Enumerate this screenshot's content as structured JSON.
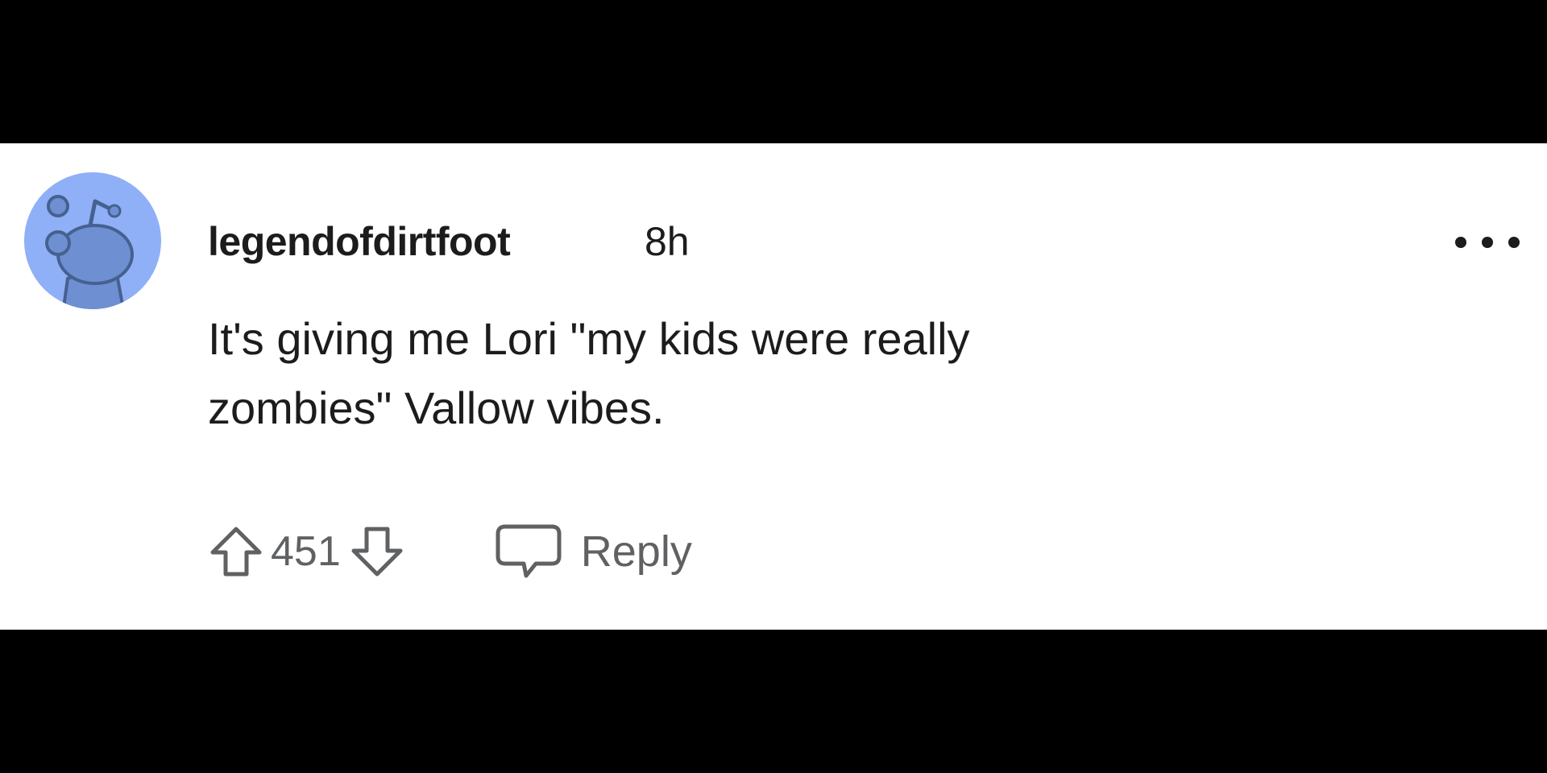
{
  "comment": {
    "avatar_icon": "reddit-snoo-avatar",
    "avatar_color": "#8fb0f7",
    "username": "legendofdirtfoot",
    "timestamp": "8h",
    "body": "It's giving me Lori \"my kids were really\nzombies\" Vallow vibes.",
    "more_icon": "more-dots-icon",
    "actions": {
      "upvote_icon": "upvote-arrow-icon",
      "score": "451",
      "downvote_icon": "downvote-arrow-icon",
      "reply_icon": "speech-bubble-icon",
      "reply_label": "Reply"
    }
  },
  "colors": {
    "text": "#1c1c1c",
    "muted": "#5f6163",
    "background": "#ffffff",
    "letterbox": "#000000"
  }
}
